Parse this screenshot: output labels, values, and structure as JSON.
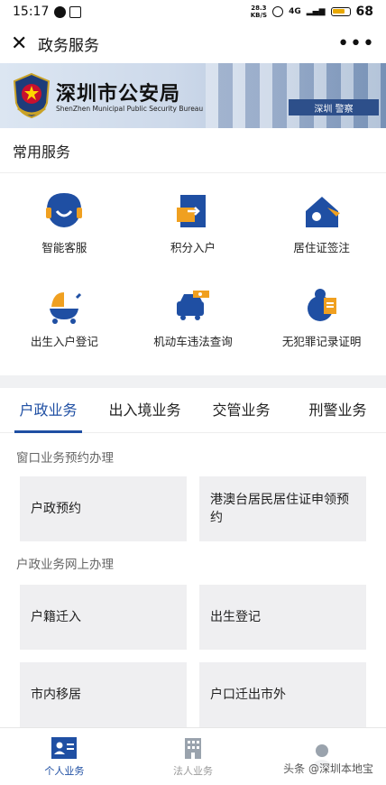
{
  "status": {
    "time": "15:17",
    "speed": "28.3\nKB/S",
    "signal": "4G",
    "battery": "68"
  },
  "header": {
    "title": "政务服务"
  },
  "banner": {
    "name_cn": "深圳市公安局",
    "name_en": "ShenZhen Municipal Public Security Bureau",
    "sign_text": "深圳 警察"
  },
  "common_services": {
    "title": "常用服务",
    "items": [
      {
        "label": "智能客服",
        "icon": "customer-service-icon"
      },
      {
        "label": "积分入户",
        "icon": "points-household-icon"
      },
      {
        "label": "居住证签注",
        "icon": "residence-permit-icon"
      },
      {
        "label": "出生入户登记",
        "icon": "birth-registration-icon"
      },
      {
        "label": "机动车违法查询",
        "icon": "vehicle-violation-icon"
      },
      {
        "label": "无犯罪记录证明",
        "icon": "no-criminal-record-icon"
      }
    ]
  },
  "tabs": [
    {
      "label": "户政业务",
      "active": true
    },
    {
      "label": "出入境业务",
      "active": false
    },
    {
      "label": "交管业务",
      "active": false
    },
    {
      "label": "刑警业务",
      "active": false
    }
  ],
  "sections": [
    {
      "title": "窗口业务预约办理",
      "cards": [
        "户政预约",
        "港澳台居民居住证申领预约"
      ]
    },
    {
      "title": "户政业务网上办理",
      "cards": [
        "户籍迁入",
        "出生登记",
        "市内移居",
        "户口迁出市外"
      ]
    }
  ],
  "bottom_nav": [
    {
      "label": "个人业务",
      "active": true,
      "icon": "person-card-icon"
    },
    {
      "label": "法人业务",
      "active": false,
      "icon": "building-icon"
    },
    {
      "label": "",
      "active": false,
      "icon": "user-avatar-icon"
    }
  ],
  "watermark": "头条 @深圳本地宝",
  "colors": {
    "accent": "#1f4fa3",
    "icon_orange": "#f0a020",
    "card_bg": "#efeff1"
  }
}
